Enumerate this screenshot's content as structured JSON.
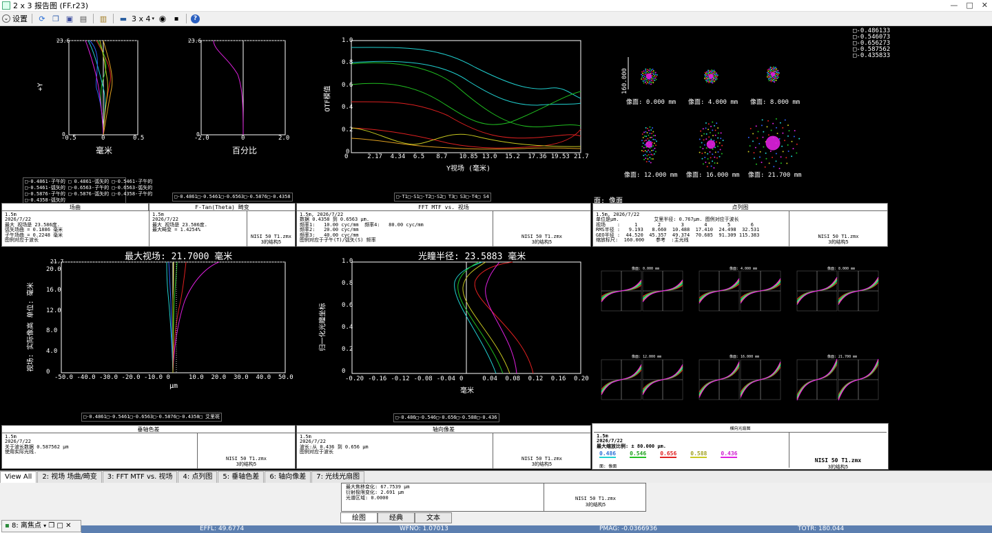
{
  "window": {
    "title": "2 x 3 报告图 (FF.r23)",
    "min": "—",
    "max": "□",
    "close": "✕"
  },
  "toolbar": {
    "settings_label": "设置",
    "layout_label": "3 x 4"
  },
  "icons": {
    "settings": "chevron-down-icon",
    "refresh": "refresh-icon",
    "copy": "copy-icon",
    "save": "save-icon",
    "print": "print-icon",
    "lock": "lock-icon",
    "window": "window-icon",
    "layout": "layout-icon",
    "clock": "clock-icon",
    "stop": "stop-icon",
    "help": "help-icon"
  },
  "colors": {
    "red": "#e02020",
    "green": "#20c020",
    "blue": "#3060ff",
    "cyan": "#20d0d0",
    "yellow": "#c8c820",
    "magenta": "#e020e0",
    "orange": "#e0a020"
  },
  "field_curve": {
    "ylabel": "+Y",
    "xlabel1": "毫米",
    "xlabel2": "百分比",
    "ymax": "23.6",
    "y0": "0",
    "x1": [
      "-0.5",
      "0",
      "0.5"
    ],
    "x2": [
      "-2.0",
      "0",
      "2.0"
    ],
    "legend1": [
      "□-0.4861-子午的",
      "□ 0.4861-弧矢的",
      "□-0.5461-子午的",
      "□-0.5461-弧矢的",
      "□-0.6563-子午的",
      "□-0.6563-弧矢的",
      "□-0.5876-子午的",
      "□-0.5876-弧矢的",
      "□-0.4358-子午的",
      "□-0.4358-弧矢的"
    ],
    "legend2": "□-0.4861□-0.5461□-0.6563□-0.5876□-0.4358"
  },
  "mtf": {
    "ylabel": "OTF模值",
    "xlabel": "Y视场 (毫米)",
    "yticks": [
      "1.0",
      "0.8",
      "0.6",
      "0.4",
      "0.2",
      "0"
    ],
    "xticks": [
      "0",
      "2.17",
      "4.34",
      "6.5",
      "8.7",
      "10.85",
      "13.0",
      "15.2",
      "17.36",
      "19.53",
      "21.7"
    ],
    "legend": "□-T1□-S1□-T2□-S2□ T3□ S3□-T4□ S4"
  },
  "spot": {
    "scale": "160.000",
    "labels": [
      "像面: 0.000 mm",
      "像面: 4.000 mm",
      "像面: 8.000 mm",
      "像面: 12.000 mm",
      "像面: 16.000 mm",
      "像面: 21.700 mm"
    ],
    "legend": [
      "□-0.486133",
      "□-0.546073",
      "□-0.656273",
      "□-0.587562",
      "□-0.435833"
    ],
    "surface": "面: 像面"
  },
  "panels": {
    "p1": {
      "title": "场曲",
      "body": "1.5m\n2026/7/22\n最大 视场是 23.586度.\n弧矢场曲 = 0.1886 毫米\n子午场曲 = 0.2248 毫米\n图例对应于波长"
    },
    "p2": {
      "title": "F-Tan(Theta) 畸变",
      "body": "1.5m\n2026/7/22\n最大 视场是 23.586度.\n最大畸变 = 1.4254%",
      "foot1": "NISI 50 T1.zmx",
      "foot2": "3的结构5"
    },
    "p3": {
      "title": "FFT MTF vs. 视场",
      "body": "1.5m, 2026/7/22\n数据 0.4358 到 0.6563 μm.\n频率1:   10.00 cyc/mm  频率4:   80.00 cyc/mm\n频率2:   20.00 cyc/mm\n频率3:   40.00 cyc/mm\n图例对应于子午(T)/弧矢(S) 频率",
      "foot1": "NISI 50 T1.zmx",
      "foot2": "3的结构5"
    },
    "p4": {
      "title": "点列图",
      "body": "1.5m, 2026/7/22\n单位是μm.            艾里半径: 0.767μm. 图例对应于波长\n视场    :     1       2       3       4       5       6\nRMS半径 :   9.193   8.660  10.488  17.410  24.498  32.531\nGEO半径 :  44.520  45.357  49.374  70.685  91.309 115.383\n缩放标尺:  160.000    参考  :主光线",
      "foot1": "NISI 50 T1.zmx",
      "foot2": "3的结构5"
    },
    "p5": {
      "title": "垂轴色差",
      "body": "1.5m\n2026/7/22\n关于波长数据 0.587562 μm\n使用实际光线.",
      "foot1": "NISI 50 T1.zmx",
      "foot2": "3的结构5"
    },
    "p6": {
      "title": "轴向像差",
      "body": "1.5m\n2026/7/22\n波长:从 0.436 到 0.656 μm\n图例对应于波长",
      "foot1": "NISI 50 T1.zmx",
      "foot2": "3的结构5"
    },
    "p7": {
      "title": "横向光扇图",
      "body": "1.5m\n2026/7/22\n最大缩放比例: ± 80.000 μm.",
      "foot1": "NISI 50 T1.zmx",
      "foot2": "3的结构5",
      "surface": "面: 像面",
      "waves": [
        "0.486",
        "0.546",
        "0.656",
        "0.588",
        "0.436"
      ]
    }
  },
  "distortion": {
    "title": "最大视场: 21.7000 毫米",
    "ylabel": "视场: 实际像高 单位: 毫米",
    "xlabel": "μm",
    "ytop": "21.7",
    "yticks": [
      "20.0",
      "16.0",
      "12.0",
      "8.0",
      "4.0",
      "0"
    ],
    "xticks": [
      "-50.0",
      "-40.0",
      "-30.0",
      "-20.0",
      "-10.0",
      "0",
      "10.0",
      "20.0",
      "30.0",
      "40.0",
      "50.0"
    ],
    "legend": "□-0.4861□-0.5461□-0.6563□-0.5876□-0.4358□ 艾里斑"
  },
  "axial": {
    "title": "光瞳半径: 23.5883 毫米",
    "ylabel": "归一化光瞳坐标",
    "xlabel": "毫米",
    "yticks": [
      "1.0",
      "0.8",
      "0.6",
      "0.4",
      "0.2",
      "0"
    ],
    "xticks": [
      "-0.20",
      "-0.16",
      "-0.12",
      "-0.08",
      "-0.04",
      "0",
      "0.04",
      "0.08",
      "0.12",
      "0.16",
      "0.20"
    ],
    "legend": "□-0.486□-0.546□-0.656□-0.588□-0.436"
  },
  "fan": {
    "labels": [
      "像面: 0.000 mm",
      "像面: 4.000 mm",
      "像面: 8.000 mm",
      "像面: 12.000 mm",
      "像面: 16.000 mm",
      "像面: 21.700 mm"
    ]
  },
  "tabs": [
    "View All",
    "2: 视场 场曲/畸变",
    "3: FFT MTF vs. 视场",
    "4: 点列图",
    "5: 垂轴色差",
    "6: 轴向像差",
    "7: 光线光扇图"
  ],
  "mini": {
    "body": "最大焦移变化: 67.7539 μm\n衍射极限变化: 2.691 μm\n光谱区域: 0.0000",
    "foot1": "NISI 50 T1.zmx",
    "foot2": "3的结构5"
  },
  "bottom_tabs": [
    "绘图",
    "经典",
    "文本"
  ],
  "minimized": "8: 离焦点",
  "status": {
    "effl": "EFFL: 49.6774",
    "wfno": "WFNO: 1.07013",
    "pmag": "PMAG: -0.0366936",
    "totr": "TOTR: 180.044"
  }
}
